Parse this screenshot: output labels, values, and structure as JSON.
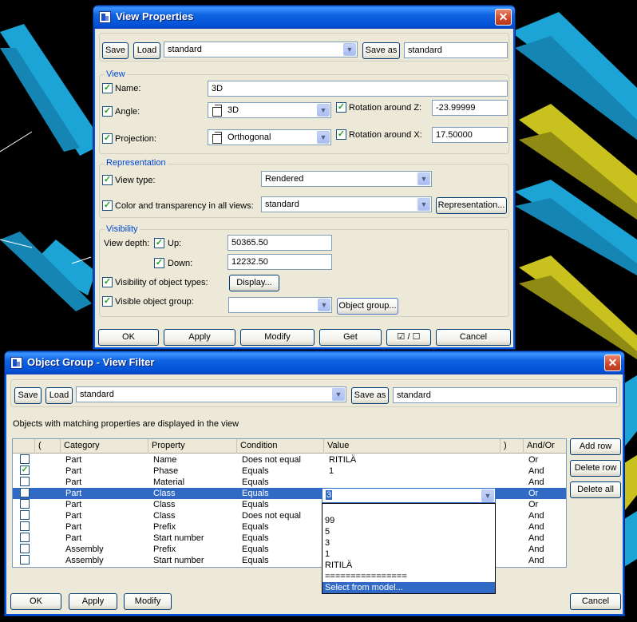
{
  "view_properties": {
    "title": "View Properties",
    "toolbar": {
      "save": "Save",
      "load": "Load",
      "preset": "standard",
      "save_as": "Save as",
      "save_as_name": "standard"
    },
    "view": {
      "group_label": "View",
      "name_label": "Name:",
      "name_value": "3D",
      "angle_label": "Angle:",
      "angle_value": "3D",
      "rot_z_label": "Rotation around Z:",
      "rot_z_value": "-23.99999",
      "projection_label": "Projection:",
      "projection_value": "Orthogonal",
      "rot_x_label": "Rotation around X:",
      "rot_x_value": "17.50000"
    },
    "representation": {
      "group_label": "Representation",
      "view_type_label": "View type:",
      "view_type_value": "Rendered",
      "color_label": "Color and transparency in all views:",
      "color_value": "standard",
      "representation_button": "Representation..."
    },
    "visibility": {
      "group_label": "Visibility",
      "view_depth_label": "View depth:",
      "up_label": "Up:",
      "up_value": "50365.50",
      "down_label": "Down:",
      "down_value": "12232.50",
      "object_types_label": "Visibility of object types:",
      "display_button": "Display...",
      "object_group_label": "Visible object group:",
      "object_group_value": "",
      "object_group_button": "Object group..."
    },
    "footer": {
      "ok": "OK",
      "apply": "Apply",
      "modify": "Modify",
      "get": "Get",
      "toggle": "☑ / ☐",
      "cancel": "Cancel"
    }
  },
  "object_group": {
    "title": "Object Group - View Filter",
    "toolbar": {
      "save": "Save",
      "load": "Load",
      "preset": "standard",
      "save_as": "Save as",
      "save_as_name": "standard"
    },
    "description": "Objects with matching properties are displayed in the view",
    "columns": [
      "(",
      "Category",
      "Property",
      "Condition",
      "Value",
      ")",
      "And/Or"
    ],
    "rows": [
      {
        "checked": false,
        "category": "Part",
        "property": "Name",
        "condition": "Does not equal",
        "value": "RITILÄ",
        "andor": "Or"
      },
      {
        "checked": true,
        "category": "Part",
        "property": "Phase",
        "condition": "Equals",
        "value": "1",
        "andor": "And"
      },
      {
        "checked": false,
        "category": "Part",
        "property": "Material",
        "condition": "Equals",
        "value": "",
        "andor": "And"
      },
      {
        "checked": false,
        "category": "Part",
        "property": "Class",
        "condition": "Equals",
        "value": "3",
        "andor": "Or"
      },
      {
        "checked": false,
        "category": "Part",
        "property": "Class",
        "condition": "Equals",
        "value": "",
        "andor": "Or"
      },
      {
        "checked": false,
        "category": "Part",
        "property": "Class",
        "condition": "Does not equal",
        "value": "",
        "andor": "And"
      },
      {
        "checked": false,
        "category": "Part",
        "property": "Prefix",
        "condition": "Equals",
        "value": "",
        "andor": "And"
      },
      {
        "checked": false,
        "category": "Part",
        "property": "Start number",
        "condition": "Equals",
        "value": "",
        "andor": "And"
      },
      {
        "checked": false,
        "category": "Assembly",
        "property": "Prefix",
        "condition": "Equals",
        "value": "",
        "andor": "And"
      },
      {
        "checked": false,
        "category": "Assembly",
        "property": "Start number",
        "condition": "Equals",
        "value": "",
        "andor": "And"
      }
    ],
    "value_dropdown": {
      "current": "3",
      "options": [
        "",
        "99",
        "5",
        "3",
        "1",
        "RITILÄ",
        "================",
        "Select from model..."
      ]
    },
    "side_buttons": {
      "add_row": "Add row",
      "delete_row": "Delete row",
      "delete_all": "Delete all"
    },
    "footer": {
      "ok": "OK",
      "apply": "Apply",
      "modify": "Modify",
      "cancel": "Cancel"
    }
  },
  "colors": {
    "selection": "#316ac5",
    "window_bg": "#ece9d8",
    "group_title": "#0046d5"
  }
}
